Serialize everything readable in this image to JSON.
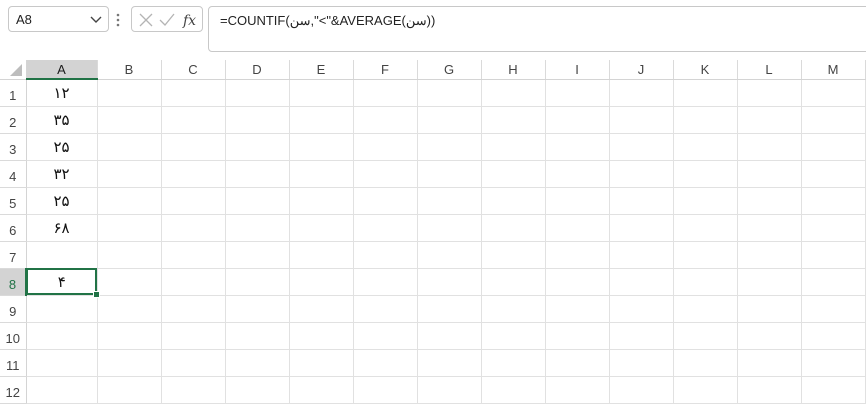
{
  "name_box": {
    "value": "A8"
  },
  "formula_bar": {
    "formula": "=COUNTIF(سن,\"<\"&AVERAGE(سن))"
  },
  "columns": [
    "A",
    "B",
    "C",
    "D",
    "E",
    "F",
    "G",
    "H",
    "I",
    "J",
    "K",
    "L",
    "M"
  ],
  "rows": [
    "1",
    "2",
    "3",
    "4",
    "5",
    "6",
    "7",
    "8",
    "9",
    "10",
    "11",
    "12"
  ],
  "cells": {
    "A1": "۱۲",
    "A2": "۳۵",
    "A3": "۲۵",
    "A4": "۳۲",
    "A5": "۲۵",
    "A6": "۶۸",
    "A7": "",
    "A8": "۴"
  },
  "active_cell": "A8",
  "colors": {
    "accent": "#217346",
    "selected_header": "#d3d3d3",
    "gridline": "#e1e1e1"
  },
  "icons": [
    "chevron-down-icon",
    "more-options-icon",
    "cancel-icon",
    "enter-icon",
    "function-icon",
    "select-all-triangle-icon"
  ]
}
